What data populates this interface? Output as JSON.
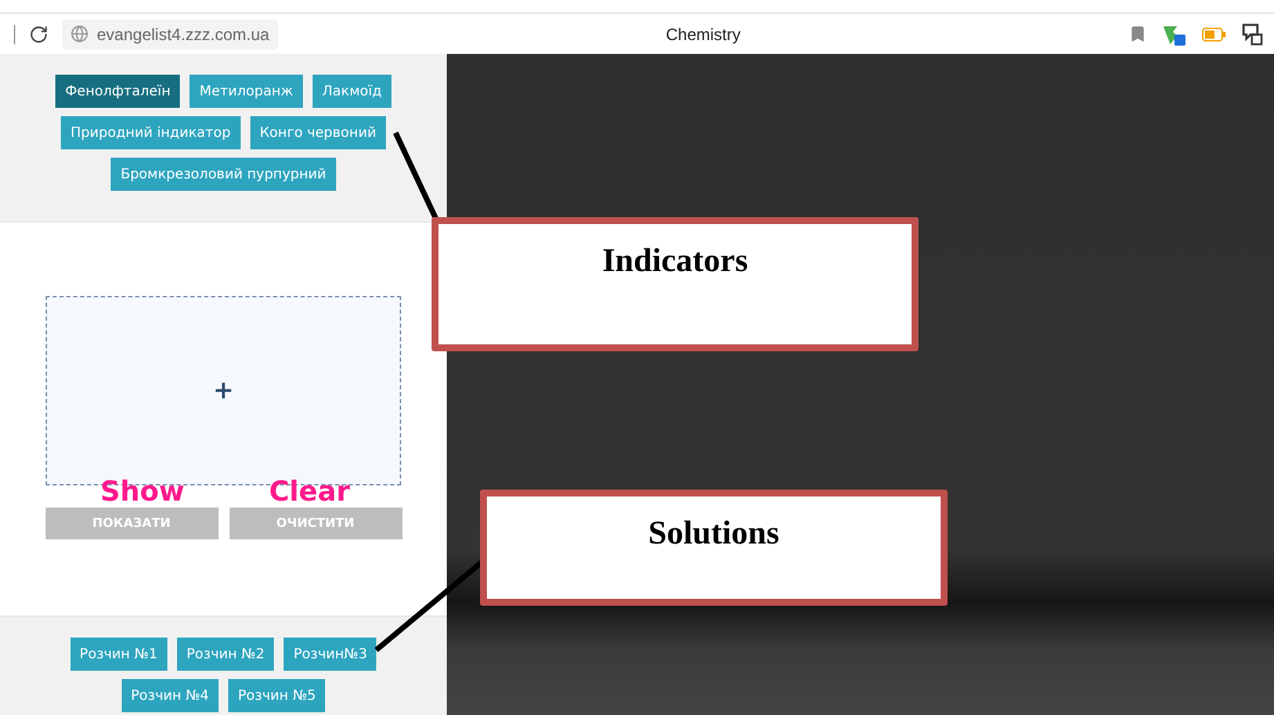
{
  "browser": {
    "url": "evangelist4.zzz.com.ua",
    "title": "Chemistry"
  },
  "indicators": [
    {
      "label": "Фенолфталеїн",
      "selected": true
    },
    {
      "label": "Метилоранж",
      "selected": false
    },
    {
      "label": "Лакмоїд",
      "selected": false
    },
    {
      "label": "Природний індикатор",
      "selected": false
    },
    {
      "label": "Конго червоний",
      "selected": false
    },
    {
      "label": "Бромкрезоловий пурпурний",
      "selected": false
    }
  ],
  "drop_zone": {
    "symbol": "+"
  },
  "actions": [
    {
      "label": "ПОКАЗАТИ",
      "annotation": "Show"
    },
    {
      "label": "ОЧИСТИТИ",
      "annotation": "Clear"
    }
  ],
  "solutions": [
    {
      "label": "Розчин №1"
    },
    {
      "label": "Розчин №2"
    },
    {
      "label": "Розчин№3"
    },
    {
      "label": "Розчин №4"
    },
    {
      "label": "Розчин №5"
    }
  ],
  "callouts": [
    {
      "text": "Indicators"
    },
    {
      "text": "Solutions"
    }
  ]
}
